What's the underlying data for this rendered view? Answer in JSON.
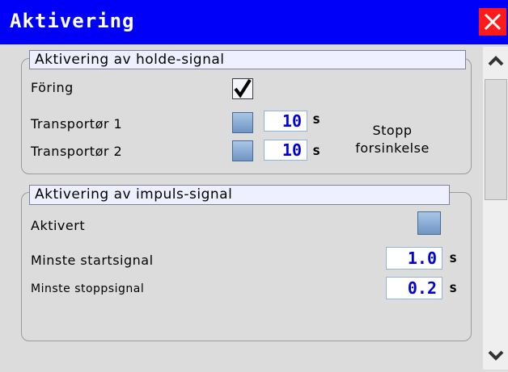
{
  "window": {
    "title": "Aktivering"
  },
  "hold_section": {
    "header": "Aktivering av holde-signal",
    "foring_label": "Föring",
    "foring_checked": true,
    "t1_label": "Transportør 1",
    "t1_value": "10",
    "t1_unit": "s",
    "t2_label": "Transportør 2",
    "t2_value": "10",
    "t2_unit": "s",
    "delay_line1": "Stopp",
    "delay_line2": "forsinkelse"
  },
  "impulse_section": {
    "header": "Aktivering av impuls-signal",
    "active_label": "Aktivert",
    "min_start_label": "Minste startsignal",
    "min_start_value": "1.0",
    "min_start_unit": "s",
    "min_stop_label": "Minste stoppsignal",
    "min_stop_value": "0.2",
    "min_stop_unit": "s"
  },
  "colors": {
    "titlebar": "#0000f8",
    "close": "#ff1a1a",
    "value_text": "#0000dd"
  },
  "icons": {
    "close": "close-icon",
    "check": "checkmark-icon",
    "up": "chevron-up-icon",
    "down": "chevron-down-icon"
  }
}
